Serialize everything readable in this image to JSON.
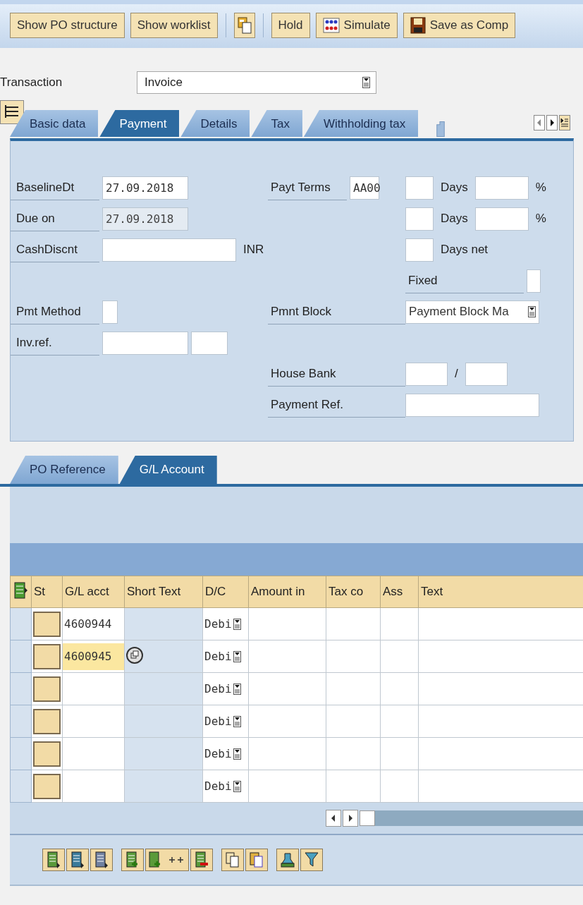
{
  "toolbar": [
    {
      "kind": "text",
      "label": "Show PO structure"
    },
    {
      "kind": "text",
      "label": "Show worklist"
    },
    {
      "kind": "separator"
    },
    {
      "kind": "icon"
    },
    {
      "kind": "separator"
    },
    {
      "kind": "text",
      "label": "Hold"
    },
    {
      "kind": "icon_text",
      "label": "Simulate"
    },
    {
      "kind": "icon_text",
      "label": "Save as Comp"
    }
  ],
  "transaction": {
    "label": "Transaction",
    "value": "Invoice"
  },
  "header_tabs": [
    {
      "label": "Basic data",
      "selected": false
    },
    {
      "label": "Payment",
      "selected": true
    },
    {
      "label": "Details",
      "selected": false
    },
    {
      "label": "Tax",
      "selected": false
    },
    {
      "label": "Withholding tax",
      "selected": false
    }
  ],
  "payment_rows": [
    {
      "a": [
        {
          "kind": "label",
          "text": "BaselineDt"
        },
        {
          "kind": "date",
          "value": "27.09.2018",
          "disabled": false
        }
      ],
      "b": [
        {
          "kind": "label",
          "text": "Payt Terms"
        },
        {
          "kind": "code",
          "value": "AA00"
        }
      ],
      "c": [
        {
          "kind": "small"
        },
        {
          "kind": "unit",
          "text": "Days"
        },
        {
          "kind": "percent"
        },
        {
          "kind": "unit",
          "text": "%"
        }
      ]
    },
    {
      "a": [
        {
          "kind": "label",
          "text": "Due on"
        },
        {
          "kind": "date",
          "value": "27.09.2018",
          "disabled": true
        }
      ],
      "b": [],
      "c": [
        {
          "kind": "small"
        },
        {
          "kind": "unit",
          "text": "Days"
        },
        {
          "kind": "percent"
        },
        {
          "kind": "unit",
          "text": "%"
        }
      ]
    },
    {
      "a": [
        {
          "kind": "label",
          "text": "CashDiscnt"
        },
        {
          "kind": "amount"
        },
        {
          "kind": "unit",
          "text": "INR"
        }
      ],
      "b": [],
      "c": [
        {
          "kind": "small"
        },
        {
          "kind": "unit",
          "text": "Days net"
        }
      ]
    },
    {
      "a": [],
      "b": [],
      "c": [
        {
          "kind": "label",
          "text": "Fixed"
        },
        {
          "kind": "check",
          "checked": false
        }
      ]
    },
    {
      "a": [
        {
          "kind": "label",
          "text": "Pmt Method"
        },
        {
          "kind": "tiny"
        }
      ],
      "b": [
        {
          "kind": "label",
          "text": "Pmnt Block"
        }
      ],
      "c": [
        {
          "kind": "dropdown",
          "value": "Payment Block Ma"
        }
      ]
    },
    {
      "a": [
        {
          "kind": "label",
          "text": "Inv.ref."
        },
        {
          "kind": "ref"
        },
        {
          "kind": "ref_short"
        }
      ],
      "b": [],
      "c": []
    },
    {
      "a": [],
      "b": [
        {
          "kind": "label",
          "text": "House Bank"
        }
      ],
      "c": [
        {
          "kind": "bank"
        },
        {
          "kind": "unit",
          "text": "/"
        },
        {
          "kind": "bank"
        }
      ]
    },
    {
      "a": [],
      "b": [
        {
          "kind": "label",
          "text": "Payment Ref."
        }
      ],
      "c": [
        {
          "kind": "wide"
        }
      ]
    }
  ],
  "item_tabs": [
    {
      "label": "PO Reference",
      "selected": false
    },
    {
      "label": "G/L Account",
      "selected": true
    }
  ],
  "table": {
    "columns": [
      "St",
      "G/L acct",
      "Short Text",
      "D/C",
      "Amount in",
      "Tax co",
      "Ass",
      "Text"
    ],
    "rows": [
      {
        "gl_acct": "4600944",
        "dc": "Debi",
        "focused": false
      },
      {
        "gl_acct": "4600945",
        "dc": "Debi",
        "focused": true
      },
      {
        "gl_acct": "",
        "dc": "Debi",
        "focused": false
      },
      {
        "gl_acct": "",
        "dc": "Debi",
        "focused": false
      },
      {
        "gl_acct": "",
        "dc": "Debi",
        "focused": false
      },
      {
        "gl_acct": "",
        "dc": "Debi",
        "focused": false
      }
    ]
  }
}
